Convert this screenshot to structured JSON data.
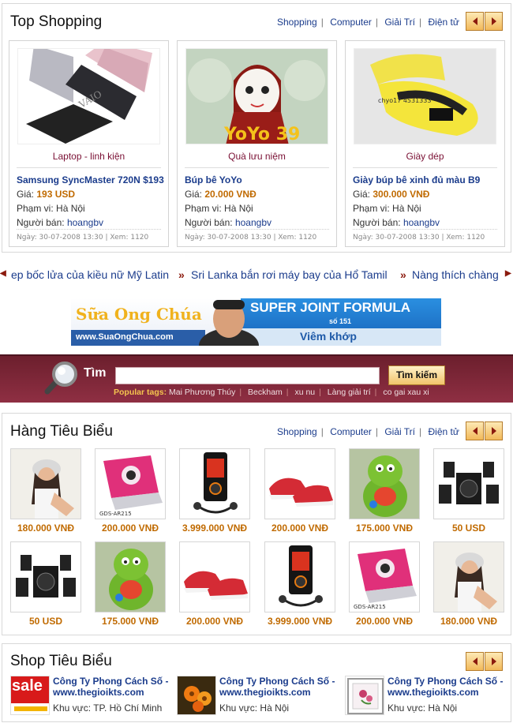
{
  "top_shopping": {
    "title": "Top Shopping",
    "links": [
      "Shopping",
      "Computer",
      "Giải Trí",
      "Điện tử"
    ],
    "cards": [
      {
        "category": "Laptop - linh kiện",
        "name": "Samsung SyncMaster 720N $193",
        "price_label": "Giá:",
        "price": "193 USD",
        "region_label": "Phạm vi:",
        "region": "Hà Nội",
        "seller_label": "Người bán:",
        "seller": "hoangbv",
        "meta": "Ngày: 30-07-2008 13:30 | Xem: 1120"
      },
      {
        "category": "Quà lưu niệm",
        "name": "Búp bê YoYo",
        "price_label": "Giá:",
        "price": "20.000 VNĐ",
        "region_label": "Phạm vi:",
        "region": "Hà Nội",
        "seller_label": "Người bán:",
        "seller": "hoangbv",
        "meta": "Ngày: 30-07-2008 13:30 | Xem: 1120",
        "image_text": "YoYo 39"
      },
      {
        "category": "Giày dép",
        "name": "Giày búp bê xinh đủ màu B9",
        "price_label": "Giá:",
        "price": "300.000 VNĐ",
        "region_label": "Phạm vi:",
        "region": "Hà Nội",
        "seller_label": "Người bán:",
        "seller": "hoangbv",
        "meta": "Ngày: 30-07-2008 13:30 | Xem: 1120",
        "image_text": "chyo17   4531333"
      }
    ]
  },
  "ticker": {
    "items": [
      "ep bốc lửa của kiều nữ Mỹ Latin",
      "Sri Lanka bắn rơi máy bay của Hổ Tamil",
      "Nàng thích chàng"
    ]
  },
  "banner": {
    "brand": "Sữa Ong Chúa",
    "url": "www.SuaOngChua.com",
    "headline": "SUPER JOINT FORMULA",
    "number": "số 151",
    "subline": "Viêm khớp"
  },
  "search": {
    "label": "Tìm",
    "value": "",
    "button": "Tìm kiếm",
    "tags_label": "Popular tags:",
    "tags": [
      "Mai Phương Thúy",
      "Beckham",
      "xu nu",
      "Làng giải trí",
      "co gai xau xi"
    ]
  },
  "featured_items": {
    "title": "Hàng Tiêu Biểu",
    "links": [
      "Shopping",
      "Computer",
      "Giải Trí",
      "Điện tử"
    ],
    "row1": [
      {
        "icon": "fashion-girl-image",
        "price": "180.000 VNĐ"
      },
      {
        "icon": "pink-laptop-image",
        "price": "200.000 VNĐ"
      },
      {
        "icon": "walkman-phone-image",
        "price": "3.999.000 VNĐ"
      },
      {
        "icon": "red-sneakers-image",
        "price": "200.000 VNĐ"
      },
      {
        "icon": "green-toy-image",
        "price": "175.000 VNĐ"
      },
      {
        "icon": "speakers-image",
        "price": "50 USD"
      }
    ],
    "row2": [
      {
        "icon": "speakers-image",
        "price": "50 USD"
      },
      {
        "icon": "green-toy-image",
        "price": "175.000 VNĐ"
      },
      {
        "icon": "red-sneakers-image",
        "price": "200.000 VNĐ"
      },
      {
        "icon": "walkman-phone-image",
        "price": "3.999.000 VNĐ"
      },
      {
        "icon": "pink-laptop-image",
        "price": "200.000 VNĐ"
      },
      {
        "icon": "fashion-girl-image",
        "price": "180.000 VNĐ"
      }
    ],
    "laptop_image_text": "GDS-AR215"
  },
  "featured_shops": {
    "title": "Shop Tiêu Biểu",
    "shops": [
      {
        "name": "Công Ty Phong Cách Số - www.thegioikts.com",
        "region_label": "Khu vực:",
        "region": "TP. Hồ Chí Minh",
        "logo_text": "sale"
      },
      {
        "name": "Công Ty Phong Cách Số - www.thegioikts.com",
        "region_label": "Khu vực:",
        "region": "Hà Nội"
      },
      {
        "name": "Công Ty Phong Cách Số - www.thegioikts.com",
        "region_label": "Khu vực:",
        "region": "Hà Nội"
      }
    ]
  },
  "colors": {
    "accent": "#1b3c8c",
    "maroon": "#8b1a0e",
    "price": "#c06a00",
    "search_bar": "#7a2536"
  }
}
